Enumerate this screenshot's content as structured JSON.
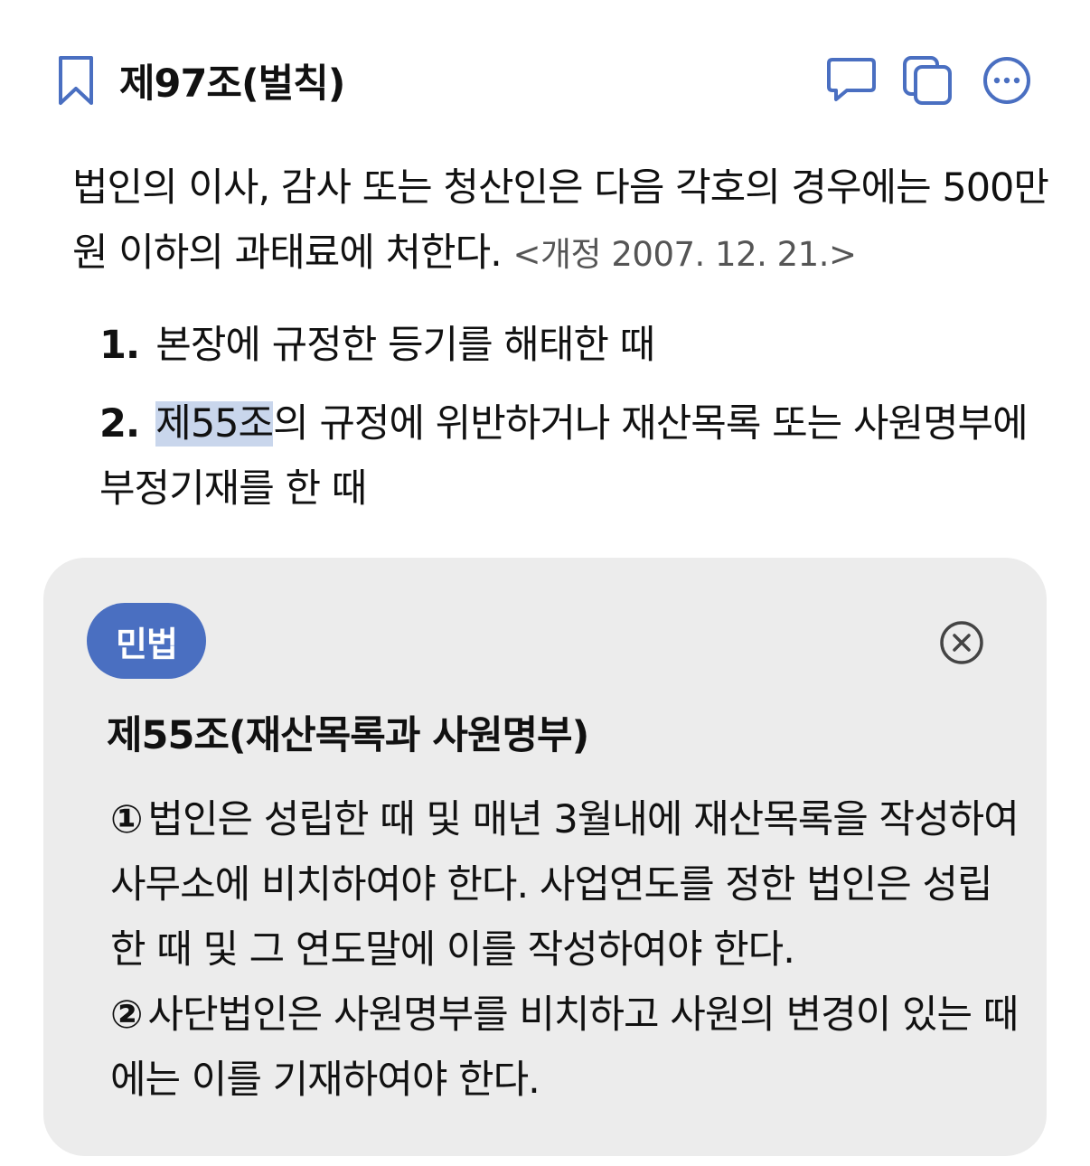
{
  "header": {
    "title": "제97조(벌칙)"
  },
  "article": {
    "paragraph": "법인의 이사, 감사 또는 청산인은 다음 각호의 경우에는 500만원 이하의 과태료에 처한다.",
    "amendment": "<개정 2007. 12. 21.>",
    "items": [
      {
        "number": "1.",
        "text": "본장에 규정한 등기를 해태한 때"
      },
      {
        "number": "2.",
        "link": "제55조",
        "text": "의 규정에 위반하거나 재산목록 또는 사원명부에 부정기재를 한 때"
      }
    ]
  },
  "popup": {
    "badge": "민법",
    "title": "제55조(재산목록과 사원명부)",
    "clauses": [
      {
        "mark": "①",
        "text": "법인은 성립한 때 및 매년 3월내에 재산목록을 작성하여 사무소에 비치하여야 한다. 사업연도를 정한 법인은 성립한 때 및 그 연도말에 이를 작성하여야 한다."
      },
      {
        "mark": "②",
        "text": "사단법인은 사원명부를 비치하고 사원의 변경이 있는 때에는 이를 기재하여야 한다."
      }
    ]
  },
  "colors": {
    "accent": "#4a6fc1",
    "highlight": "#c9d6ec",
    "card_bg": "#ececec"
  },
  "icons": [
    "bookmark-icon",
    "comment-icon",
    "copy-icon",
    "more-icon",
    "close-icon"
  ]
}
